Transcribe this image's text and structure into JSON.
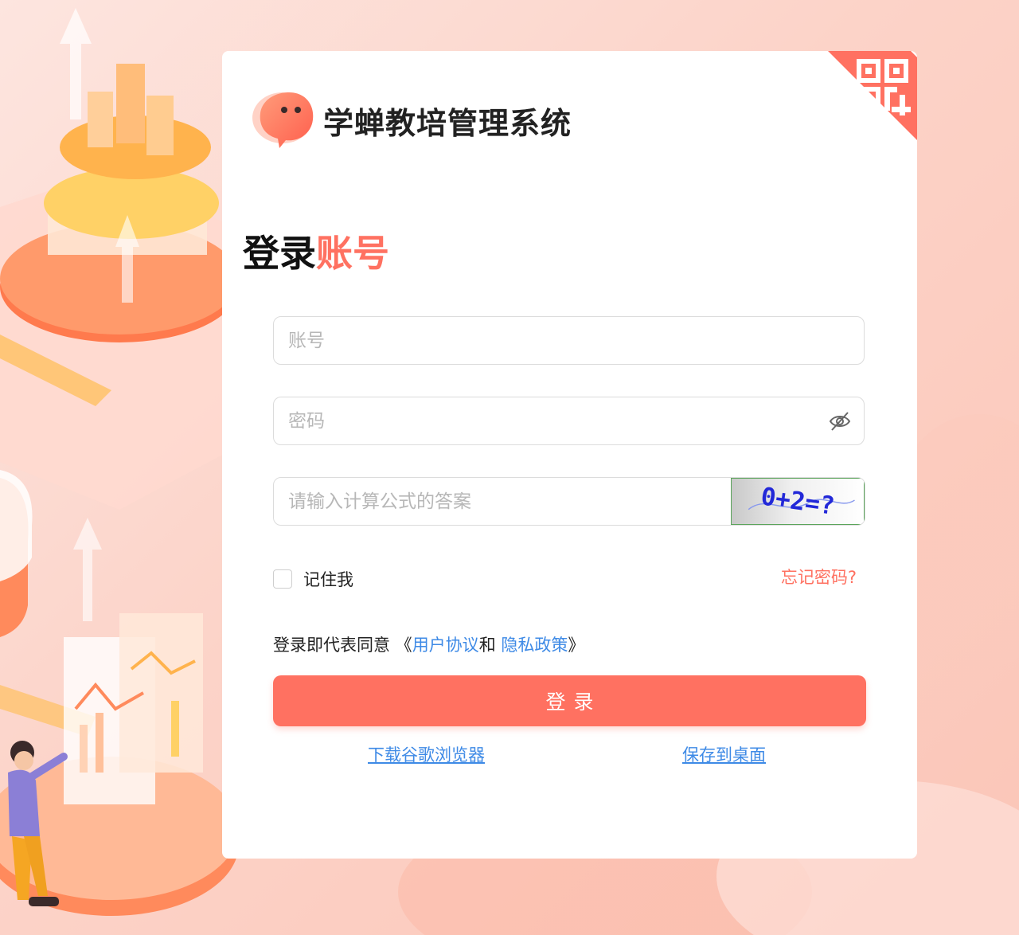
{
  "app": {
    "title": "学蝉教培管理系统"
  },
  "login": {
    "heading_part1": "登录",
    "heading_part2": "账号",
    "account_placeholder": "账号",
    "password_placeholder": "密码",
    "captcha_placeholder": "请输入计算公式的答案",
    "captcha_text": "0+2=?",
    "remember_label": "记住我",
    "remember_checked": false,
    "forgot_label": "忘记密码?",
    "agree_prefix": "登录即代表同意 《",
    "user_agreement": "用户协议",
    "agree_and": "和",
    "privacy_policy": "隐私政策",
    "agree_suffix": "》",
    "submit_label": "登录"
  },
  "links": {
    "download_chrome": "下载谷歌浏览器",
    "save_to_desktop": "保存到桌面"
  },
  "icons": {
    "qr": "qr-code-icon",
    "eye": "eye-off-icon",
    "logo": "chat-bubble-logo"
  },
  "colors": {
    "accent": "#ff7161",
    "link": "#3e8ae6",
    "title": "#222222"
  }
}
